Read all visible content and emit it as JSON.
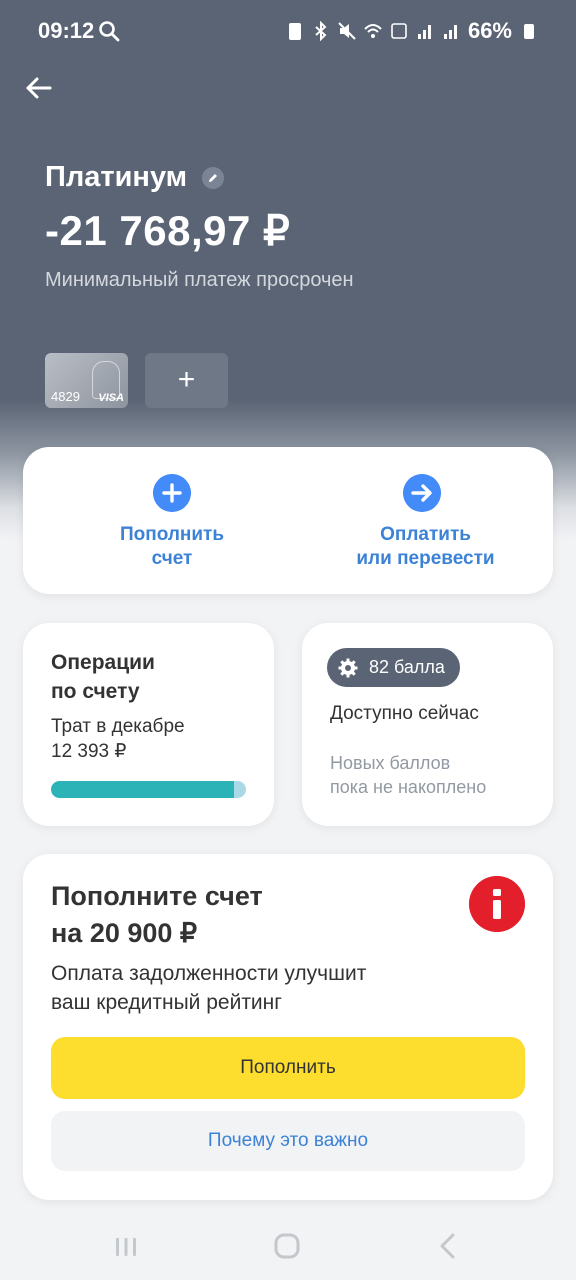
{
  "status_bar": {
    "time": "09:12",
    "battery": "66%"
  },
  "account": {
    "title": "Платинум",
    "balance": "-21 768,97 ₽",
    "status": "Минимальный платеж просрочен"
  },
  "card": {
    "last_digits": "4829",
    "brand": "VISA"
  },
  "add_card_label": "+",
  "actions": {
    "top_up": {
      "line1": "Пополнить",
      "line2": "счет"
    },
    "pay": {
      "line1": "Оплатить",
      "line2": "или перевести"
    }
  },
  "operations": {
    "title_line1": "Операции",
    "title_line2": "по счету",
    "sub_line1": "Трат в декабре",
    "sub_line2": "12 393 ₽",
    "progress": 0.94
  },
  "bonus": {
    "points": "82 балла",
    "available": "Доступно сейчас",
    "note_line1": "Новых баллов",
    "note_line2": "пока не накоплено"
  },
  "topup_prompt": {
    "title_line1": "Пополните счет",
    "title_line2": "на 20 900 ₽",
    "desc_line1": "Оплата задолженности улучшит",
    "desc_line2": "ваш кредитный рейтинг",
    "primary_button": "Пополнить",
    "secondary_button": "Почему это важно"
  },
  "colors": {
    "header_bg": "#5a6474",
    "accent_blue": "#428bf9",
    "link_blue": "#3c82d6",
    "yellow": "#fddd2d",
    "alert_red": "#e41f2c",
    "progress": "#2cb3b8"
  }
}
